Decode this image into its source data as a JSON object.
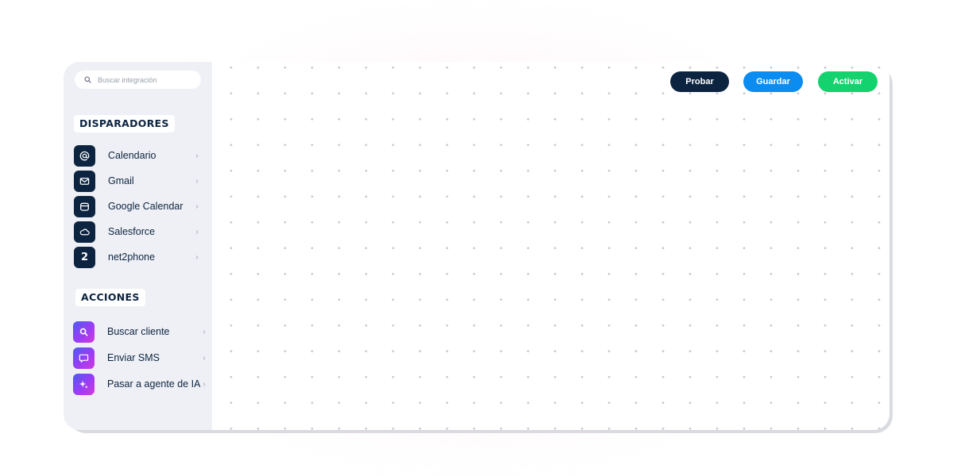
{
  "search": {
    "placeholder": "Buscar integración",
    "icon": "search-icon"
  },
  "sidebar": {
    "triggers": {
      "title": "DISPARADORES",
      "items": [
        {
          "label": "Calendario",
          "icon": "at-icon"
        },
        {
          "label": "Gmail",
          "icon": "mail-icon"
        },
        {
          "label": "Google Calendar",
          "icon": "calendar-icon"
        },
        {
          "label": "Salesforce",
          "icon": "cloud-icon"
        },
        {
          "label": "net2phone",
          "icon": "net2phone-logo-icon",
          "glyph": "2"
        }
      ]
    },
    "actions": {
      "title": "ACCIONES",
      "items": [
        {
          "label": "Buscar cliente",
          "icon": "search-icon"
        },
        {
          "label": "Enviar SMS",
          "icon": "message-icon"
        },
        {
          "label": "Pasar a agente de IA",
          "icon": "sparkles-icon"
        }
      ]
    }
  },
  "toolbar": {
    "test_label": "Probar",
    "save_label": "Guardar",
    "activate_label": "Activar"
  },
  "colors": {
    "navy": "#0d2440",
    "blue": "#0b8cf0",
    "green": "#14d36e",
    "sidebar_bg": "#eef0f5",
    "dot": "#c9ccd2"
  }
}
